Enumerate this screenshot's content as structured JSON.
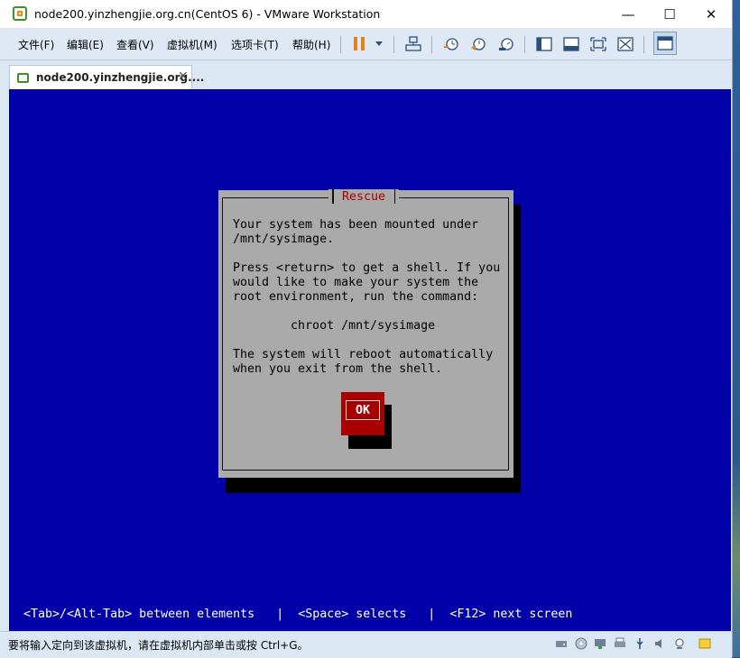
{
  "window": {
    "title": "node200.yinzhengjie.org.cn(CentOS 6) - VMware Workstation",
    "minimize_glyph": "—",
    "maximize_glyph": "☐",
    "close_glyph": "✕"
  },
  "menu": {
    "items": [
      "文件(F)",
      "编辑(E)",
      "查看(V)",
      "虚拟机(M)",
      "选项卡(T)",
      "帮助(H)"
    ]
  },
  "toolbar": {
    "icons": [
      "pause-icon",
      "send-ctrl-alt-del-icon",
      "snapshot-icon",
      "revert-snapshot-icon",
      "snapshot-manager-icon",
      "show-library-icon",
      "thumbnail-bar-icon",
      "full-screen-icon",
      "unity-icon",
      "console-view-icon"
    ],
    "accent": "#e0841a"
  },
  "tab": {
    "label": "node200.yinzhengjie.org....",
    "close_glyph": "✕"
  },
  "console": {
    "background": "#0000a8",
    "dialog": {
      "title": "Rescue",
      "lines": [
        "Your system has been mounted under",
        "/mnt/sysimage.",
        "",
        "Press <return> to get a shell. If you",
        "would like to make your system the",
        "root environment, run the command:",
        "",
        "        chroot /mnt/sysimage",
        "",
        "The system will reboot automatically",
        "when you exit from the shell."
      ],
      "ok_label": "OK"
    },
    "hint": "<Tab>/<Alt-Tab> between elements   |  <Space> selects   |  <F12> next screen"
  },
  "statusbar": {
    "message": "要将输入定向到该虚拟机，请在虚拟机内部单击或按 Ctrl+G。",
    "icons": [
      "hard-disk-icon",
      "cd-dvd-icon",
      "network-icon",
      "printer-icon",
      "usb-icon",
      "sound-icon",
      "display-icon",
      "message-icon"
    ]
  }
}
